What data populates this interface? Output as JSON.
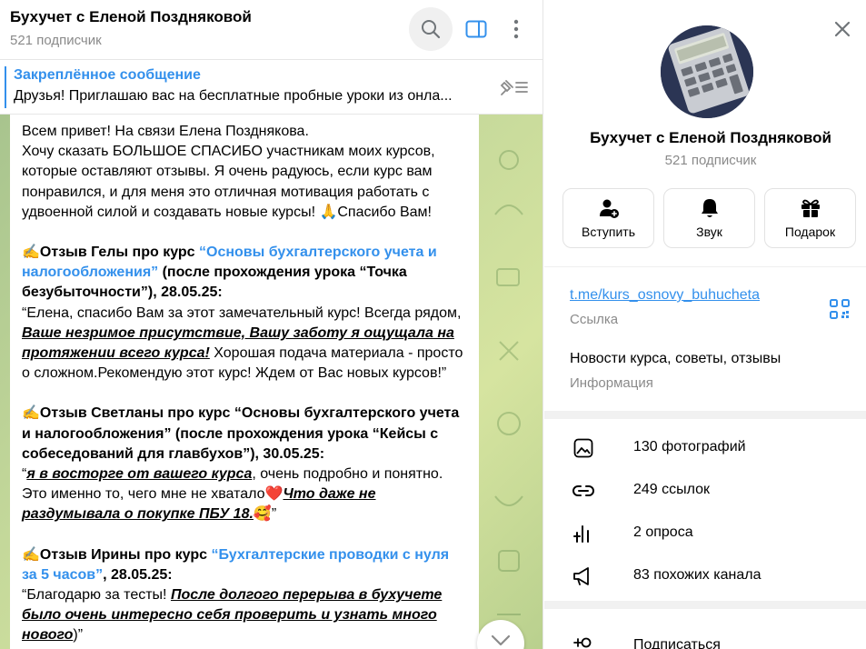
{
  "chat": {
    "title": "Бухучет с Еленой Поздняковой",
    "subscribers": "521 подписчик"
  },
  "pinned": {
    "title": "Закреплённое сообщение",
    "text": "Друзья! Приглашаю вас на бесплатные пробные уроки из онла..."
  },
  "message": {
    "p1": "Всем привет! На связи Елена Позднякова.",
    "p2": "Хочу сказать БОЛЬШОЕ СПАСИБО участникам моих курсов, которые оставляют отзывы. Я очень радуюсь, если курс вам понравился, и для меня это отличная мотивация работать с удвоенной силой и создавать новые курсы! 🙏Спасибо Вам!",
    "r1_head_pre": "✍️Отзыв Гелы про курс ",
    "r1_head_link": "“Основы бухгалтерского учета и налогообложения”",
    "r1_head_post": " (после прохождения урока “Точка безубыточности”), 28.05.25:",
    "r1_body_pre": "“Елена, спасибо Вам за этот замечательный курс! Всегда рядом, ",
    "r1_body_em": "Ваше незримое присутствие, Вашу заботу я ощущала на протяжении всего курса!",
    "r1_body_post": " Хорошая подача материала - просто о сложном.Рекомендую этот курс! Ждем от Вас новых курсов!”",
    "r2_head": "✍️Отзыв Светланы про курс “Основы бухгалтерского учета и налогообложения” (после прохождения урока “Кейсы с собеседований для главбухов”), 30.05.25:",
    "r2_body_q": "“",
    "r2_body_em1": "я в восторге от вашего курса",
    "r2_body_mid": ", очень подробно и понятно. Это именно то, чего мне не хватало❤️",
    "r2_body_em2": "Что даже не раздумывала о покупке ПБУ 18.",
    "r2_body_end": "🥰”",
    "r3_head_pre": "✍️Отзыв Ирины про курс ",
    "r3_head_link": "“Бухгалтерские проводки с нуля за 5 часов”",
    "r3_head_post": ", 28.05.25:",
    "r3_body_pre": "“Благодарю за тесты! ",
    "r3_body_em": "После долгого перерыва в бухучете было очень интересно себя проверить и узнать много нового",
    "r3_body_end": ")”"
  },
  "info": {
    "name": "Бухучет с Еленой Поздняковой",
    "subscribers": "521 подписчик",
    "actions": {
      "join": "Вступить",
      "sound": "Звук",
      "gift": "Подарок"
    },
    "link": "t.me/kurs_osnovy_buhucheta",
    "link_label": "Ссылка",
    "description": "Новости курса, советы, отзывы",
    "description_label": "Информация",
    "media": [
      {
        "icon": "photo-icon",
        "label": "130 фотографий"
      },
      {
        "icon": "link-icon",
        "label": "249 ссылок"
      },
      {
        "icon": "poll-icon",
        "label": "2 опроса"
      },
      {
        "icon": "megaphone-icon",
        "label": "83 похожих канала"
      }
    ],
    "subscribe": "Подписаться"
  },
  "colors": {
    "accent": "#3390ec",
    "muted": "#8a8a8a",
    "avatar_bg": "#2b3554"
  }
}
